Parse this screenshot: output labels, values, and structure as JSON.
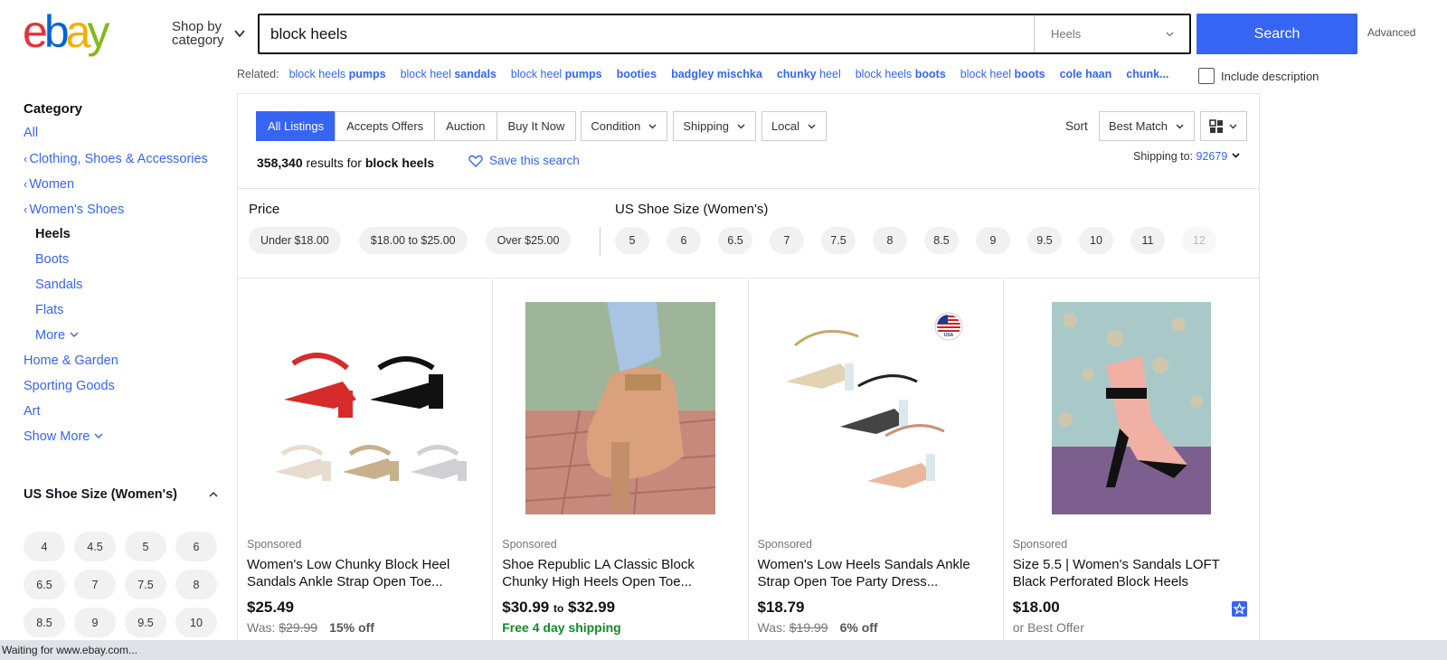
{
  "brand": {
    "logo_letters": [
      "e",
      "b",
      "a",
      "y"
    ],
    "colors": [
      "#e53238",
      "#0064d2",
      "#f5af02",
      "#86b817"
    ]
  },
  "header": {
    "shop_by": "Shop by",
    "shop_by_2": "category",
    "search_value": "block heels",
    "search_category": "Heels",
    "search_button": "Search",
    "advanced": "Advanced"
  },
  "related": {
    "label": "Related:",
    "items": [
      {
        "plain": "block heels ",
        "bold": "pumps"
      },
      {
        "plain": "block heel ",
        "bold": "sandals"
      },
      {
        "plain": "block heel ",
        "bold": "pumps"
      },
      {
        "plain": "",
        "bold": "booties"
      },
      {
        "plain": "",
        "bold": "badgley mischka"
      },
      {
        "plain": "",
        "bold": "chunky ",
        "plain2": "heel"
      },
      {
        "plain": "block heels ",
        "bold": "boots"
      },
      {
        "plain": "block heel ",
        "bold": "boots"
      },
      {
        "plain": "",
        "bold": "cole haan"
      },
      {
        "plain": "",
        "bold": "chunk..."
      }
    ],
    "include_description": "Include description"
  },
  "sidebar": {
    "heading": "Category",
    "all": "All",
    "items": [
      {
        "label": "Clothing, Shoes & Accessories",
        "type": "back"
      },
      {
        "label": "Women",
        "type": "back"
      },
      {
        "label": "Women's Shoes",
        "type": "back"
      },
      {
        "label": "Heels",
        "type": "current"
      },
      {
        "label": "Boots",
        "type": "sub"
      },
      {
        "label": "Sandals",
        "type": "sub"
      },
      {
        "label": "Flats",
        "type": "sub"
      },
      {
        "label": "More",
        "type": "sub-more"
      },
      {
        "label": "Home & Garden",
        "type": "top"
      },
      {
        "label": "Sporting Goods",
        "type": "top"
      },
      {
        "label": "Art",
        "type": "top"
      },
      {
        "label": "Show More",
        "type": "top-more"
      }
    ],
    "size_heading": "US Shoe Size (Women's)",
    "sizes": [
      "4",
      "4.5",
      "5",
      "6",
      "6.5",
      "7",
      "7.5",
      "8",
      "8.5",
      "9",
      "9.5",
      "10"
    ]
  },
  "toolbar": {
    "tabs": [
      "All Listings",
      "Accepts Offers",
      "Auction",
      "Buy It Now"
    ],
    "dropdowns": [
      "Condition",
      "Shipping",
      "Local"
    ],
    "sort_label": "Sort",
    "sort_value": "Best Match",
    "results_count": "358,340",
    "results_text": " results for ",
    "results_query": "block heels",
    "save_search": "Save this search",
    "shipping_to": "Shipping to:",
    "zip": "92679"
  },
  "filters": {
    "price_heading": "Price",
    "price_chips": [
      "Under $18.00",
      "$18.00 to $25.00",
      "Over $25.00"
    ],
    "size_heading": "US Shoe Size (Women's)",
    "size_chips": [
      "5",
      "6",
      "6.5",
      "7",
      "7.5",
      "8",
      "8.5",
      "9",
      "9.5",
      "10",
      "11",
      "12"
    ]
  },
  "listings": [
    {
      "sponsored": "Sponsored",
      "title": "Women's Low Chunky Block Heel Sandals Ankle Strap Open Toe...",
      "price": "$25.49",
      "was_label": "Was:",
      "was": "$29.99",
      "off": "15% off"
    },
    {
      "sponsored": "Sponsored",
      "title": "Shoe Republic LA Classic Block Chunky High Heels Open Toe...",
      "price": "$30.99",
      "to": "to",
      "price2": "$32.99",
      "shipping": "Free 4 day shipping"
    },
    {
      "sponsored": "Sponsored",
      "title": "Women's Low Heels Sandals Ankle Strap Open Toe Party Dress...",
      "price": "$18.79",
      "was_label": "Was:",
      "was": "$19.99",
      "off": "6% off",
      "badge": "USA"
    },
    {
      "sponsored": "Sponsored",
      "title": "Size 5.5 | Women's Sandals LOFT Black Perforated Block Heels",
      "price": "$18.00",
      "offer": "or Best Offer"
    }
  ],
  "status_bar": "Waiting for www.ebay.com..."
}
